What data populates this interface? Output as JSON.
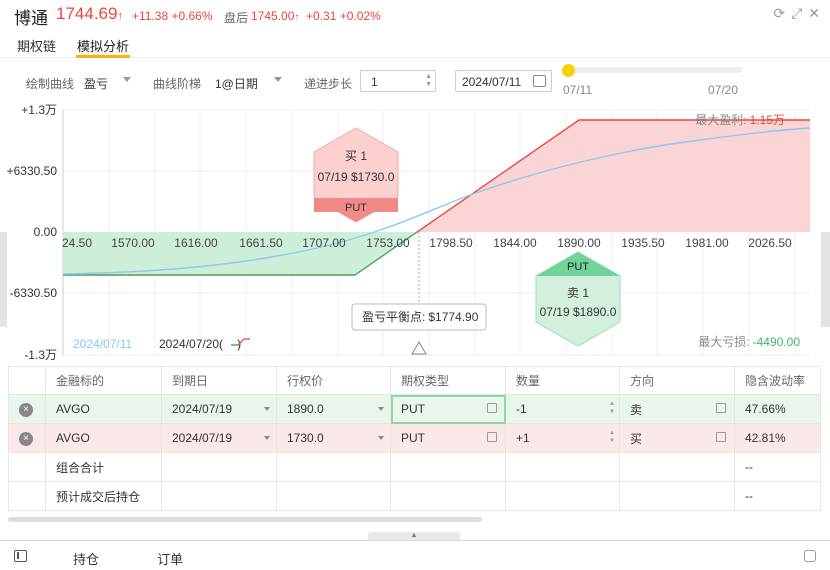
{
  "header": {
    "title": "博通",
    "price": "1744.69",
    "change": "+11.38 +0.66%",
    "after_label": "盘后",
    "after_price": "1745.00",
    "after_change": "+0.31 +0.02%"
  },
  "tabs": [
    {
      "label": "期权链"
    },
    {
      "label": "模拟分析"
    }
  ],
  "controls": {
    "curve_label": "绘制曲线",
    "curve_value": "盈亏",
    "ladder_label": "曲线阶梯",
    "ladder_value": "1@日期",
    "step_label": "递进步长",
    "step_value": "1",
    "date_value": "2024/07/11",
    "slider_start": "07/11",
    "slider_end": "07/20",
    "slider_position": 0
  },
  "chart_data": {
    "type": "line",
    "y_ticks": [
      "+1.3万",
      "+6330.50",
      "0.00",
      "-6330.50",
      "-1.3万"
    ],
    "x_ticks": [
      "24.50",
      "1570.00",
      "1616.00",
      "1661.50",
      "1707.00",
      "1753.00",
      "1798.50",
      "1844.00",
      "1890.00",
      "1935.50",
      "1981.00",
      "2026.50"
    ],
    "max_profit_label": "最大盈利:",
    "max_profit": "1.15万",
    "max_loss_label": "最大亏损:",
    "max_loss": "-4490.00",
    "breakeven_label": "盈亏平衡点:",
    "breakeven": "$1774.90",
    "leg_buy": {
      "action": "买 1",
      "detail": "07/19 $1730.0",
      "type": "PUT"
    },
    "leg_sell": {
      "action": "卖 1",
      "detail": "07/19 $1890.0",
      "type": "PUT"
    },
    "legend": [
      "2024/07/11",
      "2024/07/20(",
      ")"
    ],
    "colors": {
      "expiry": "#e8473f",
      "current": "#7cc4f0",
      "profit_fill": "#fbd5d5",
      "loss_fill": "#cdeed8"
    }
  },
  "table": {
    "headers": [
      "",
      "金融标的",
      "到期日",
      "行权价",
      "期权类型",
      "数量",
      "方向",
      "隐含波动率"
    ],
    "rows": [
      [
        "×",
        "AVGO",
        "2024/07/19",
        "1890.0",
        "PUT",
        "-1",
        "卖",
        "47.66%"
      ],
      [
        "×",
        "AVGO",
        "2024/07/19",
        "1730.0",
        "PUT",
        "+1",
        "买",
        "42.81%"
      ]
    ],
    "summary": [
      [
        "",
        "组合合计",
        "",
        "",
        "",
        "",
        "",
        "--"
      ],
      [
        "",
        "预计成交后持仓",
        "",
        "",
        "",
        "",
        "",
        "--"
      ]
    ]
  },
  "bottom": {
    "positions": "持仓",
    "orders": "订单"
  }
}
